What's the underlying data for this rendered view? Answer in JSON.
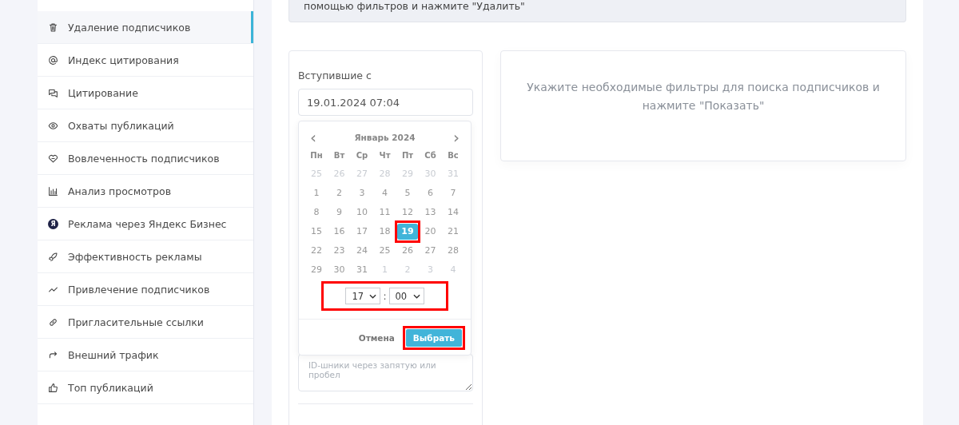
{
  "sidebar": {
    "items": [
      {
        "label": "Удаление подписчиков",
        "selected": true
      },
      {
        "label": "Индекс цитирования",
        "selected": false
      },
      {
        "label": "Цитирование",
        "selected": false
      },
      {
        "label": "Охваты публикаций",
        "selected": false
      },
      {
        "label": "Вовлеченность подписчиков",
        "selected": false
      },
      {
        "label": "Анализ просмотров",
        "selected": false
      },
      {
        "label": "Реклама через Яндекс Бизнес",
        "badge": "Я",
        "selected": false
      },
      {
        "label": "Эффективность рекламы",
        "selected": false
      },
      {
        "label": "Привлечение подписчиков",
        "selected": false
      },
      {
        "label": "Пригласительные ссылки",
        "selected": false
      },
      {
        "label": "Внешний трафик",
        "selected": false
      },
      {
        "label": "Топ публикаций",
        "selected": false
      }
    ]
  },
  "alert": {
    "text": "помощью фильтров и нажмите \"Удалить\""
  },
  "filters": {
    "joined_label": "Вступившие с",
    "joined_value": "19.01.2024 07:04",
    "ids_placeholder": "ID-шники через запятую или пробел"
  },
  "datepicker": {
    "prev": "‹",
    "next": "›",
    "month": "Январь 2024",
    "weekdays": [
      "Пн",
      "Вт",
      "Ср",
      "Чт",
      "Пт",
      "Сб",
      "Вс"
    ],
    "days": [
      {
        "label": "25",
        "muted": true,
        "selected": false,
        "highlighted": false
      },
      {
        "label": "26",
        "muted": true,
        "selected": false,
        "highlighted": false
      },
      {
        "label": "27",
        "muted": true,
        "selected": false,
        "highlighted": false
      },
      {
        "label": "28",
        "muted": true,
        "selected": false,
        "highlighted": false
      },
      {
        "label": "29",
        "muted": true,
        "selected": false,
        "highlighted": false
      },
      {
        "label": "30",
        "muted": true,
        "selected": false,
        "highlighted": false
      },
      {
        "label": "31",
        "muted": true,
        "selected": false,
        "highlighted": false
      },
      {
        "label": "1",
        "muted": false,
        "selected": false,
        "highlighted": false
      },
      {
        "label": "2",
        "muted": false,
        "selected": false,
        "highlighted": false
      },
      {
        "label": "3",
        "muted": false,
        "selected": false,
        "highlighted": false
      },
      {
        "label": "4",
        "muted": false,
        "selected": false,
        "highlighted": false
      },
      {
        "label": "5",
        "muted": false,
        "selected": false,
        "highlighted": false
      },
      {
        "label": "6",
        "muted": false,
        "selected": false,
        "highlighted": false
      },
      {
        "label": "7",
        "muted": false,
        "selected": false,
        "highlighted": false
      },
      {
        "label": "8",
        "muted": false,
        "selected": false,
        "highlighted": false
      },
      {
        "label": "9",
        "muted": false,
        "selected": false,
        "highlighted": false
      },
      {
        "label": "10",
        "muted": false,
        "selected": false,
        "highlighted": false
      },
      {
        "label": "11",
        "muted": false,
        "selected": false,
        "highlighted": false
      },
      {
        "label": "12",
        "muted": false,
        "selected": false,
        "highlighted": false
      },
      {
        "label": "13",
        "muted": false,
        "selected": false,
        "highlighted": false
      },
      {
        "label": "14",
        "muted": false,
        "selected": false,
        "highlighted": false
      },
      {
        "label": "15",
        "muted": false,
        "selected": false,
        "highlighted": false
      },
      {
        "label": "16",
        "muted": false,
        "selected": false,
        "highlighted": false
      },
      {
        "label": "17",
        "muted": false,
        "selected": false,
        "highlighted": false
      },
      {
        "label": "18",
        "muted": false,
        "selected": false,
        "highlighted": false
      },
      {
        "label": "19",
        "muted": false,
        "selected": true,
        "highlighted": true
      },
      {
        "label": "20",
        "muted": false,
        "selected": false,
        "highlighted": false
      },
      {
        "label": "21",
        "muted": false,
        "selected": false,
        "highlighted": false
      },
      {
        "label": "22",
        "muted": false,
        "selected": false,
        "highlighted": false
      },
      {
        "label": "23",
        "muted": false,
        "selected": false,
        "highlighted": false
      },
      {
        "label": "24",
        "muted": false,
        "selected": false,
        "highlighted": false
      },
      {
        "label": "25",
        "muted": false,
        "selected": false,
        "highlighted": false
      },
      {
        "label": "26",
        "muted": false,
        "selected": false,
        "highlighted": false
      },
      {
        "label": "27",
        "muted": false,
        "selected": false,
        "highlighted": false
      },
      {
        "label": "28",
        "muted": false,
        "selected": false,
        "highlighted": false
      },
      {
        "label": "29",
        "muted": false,
        "selected": false,
        "highlighted": false
      },
      {
        "label": "30",
        "muted": false,
        "selected": false,
        "highlighted": false
      },
      {
        "label": "31",
        "muted": false,
        "selected": false,
        "highlighted": false
      },
      {
        "label": "1",
        "muted": true,
        "selected": false,
        "highlighted": false
      },
      {
        "label": "2",
        "muted": true,
        "selected": false,
        "highlighted": false
      },
      {
        "label": "3",
        "muted": true,
        "selected": false,
        "highlighted": false
      },
      {
        "label": "4",
        "muted": true,
        "selected": false,
        "highlighted": false
      }
    ],
    "time": {
      "hour": "17",
      "separator": ":",
      "minute": "00",
      "highlighted": true
    },
    "cancel": "Отмена",
    "confirm": {
      "label": "Выбрать",
      "highlighted": true
    }
  },
  "result": {
    "text": "Укажите необходимые фильтры для поиска подписчиков и нажмите \"Показать\""
  }
}
